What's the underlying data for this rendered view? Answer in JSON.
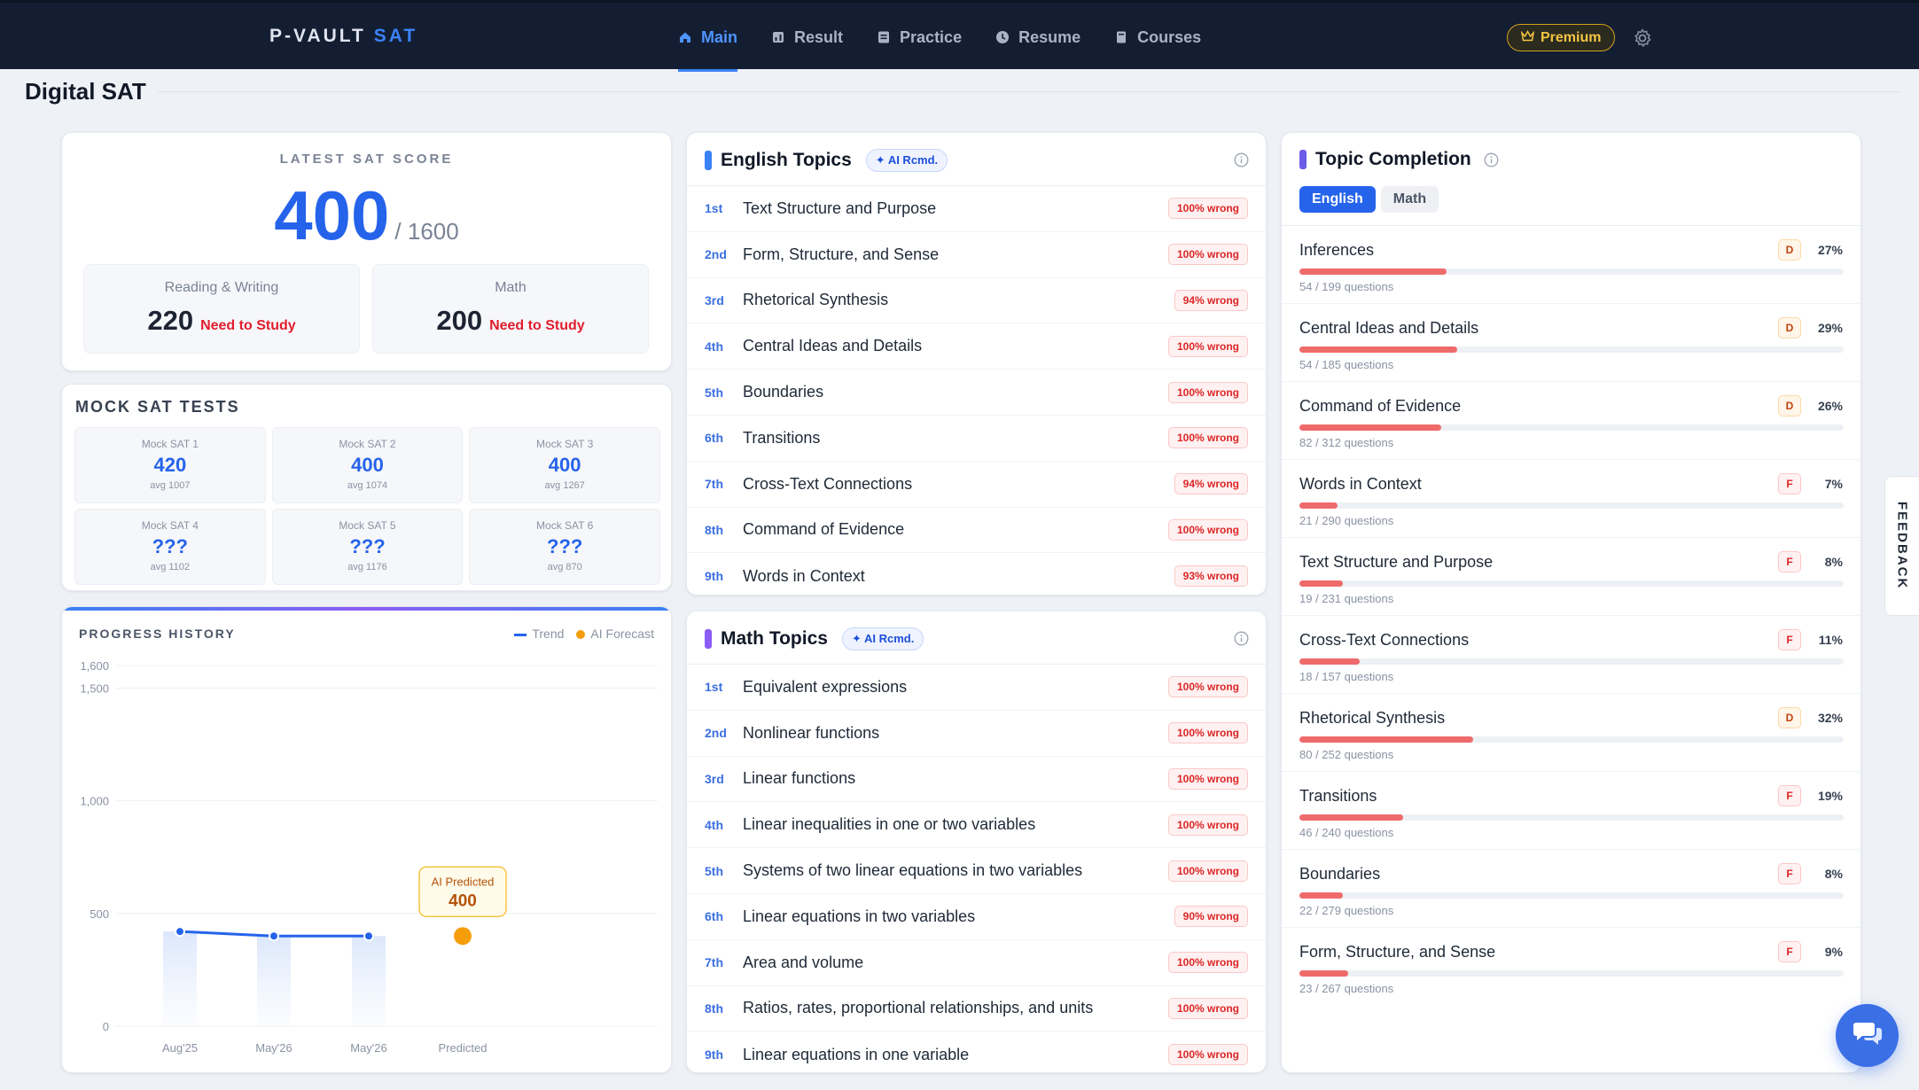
{
  "nav": {
    "logo_main": "P-VAULT",
    "logo_accent": "SAT",
    "items": [
      {
        "label": "Main",
        "icon": "home-icon"
      },
      {
        "label": "Result",
        "icon": "chart-icon"
      },
      {
        "label": "Practice",
        "icon": "doc-icon"
      },
      {
        "label": "Resume",
        "icon": "clock-icon"
      },
      {
        "label": "Courses",
        "icon": "book-icon"
      }
    ],
    "active": "Main",
    "premium": "Premium"
  },
  "page": {
    "title": "Digital SAT"
  },
  "latest": {
    "label": "LATEST SAT SCORE",
    "score": "400",
    "total": "/ 1600",
    "rw_label": "Reading & Writing",
    "rw_score": "220",
    "rw_status": "Need to Study",
    "math_label": "Math",
    "math_score": "200",
    "math_status": "Need to Study"
  },
  "mock": {
    "title": "MOCK SAT TESTS",
    "tests": [
      {
        "name": "Mock SAT 1",
        "score": "420",
        "avg": "avg 1007"
      },
      {
        "name": "Mock SAT 2",
        "score": "400",
        "avg": "avg 1074"
      },
      {
        "name": "Mock SAT 3",
        "score": "400",
        "avg": "avg 1267"
      },
      {
        "name": "Mock SAT 4",
        "score": "???",
        "avg": "avg 1102"
      },
      {
        "name": "Mock SAT 5",
        "score": "???",
        "avg": "avg 1176"
      },
      {
        "name": "Mock SAT 6",
        "score": "???",
        "avg": "avg 870"
      }
    ]
  },
  "progress": {
    "title": "PROGRESS HISTORY",
    "legend_trend": "Trend",
    "legend_forecast": "AI Forecast",
    "predicted_label": "AI Predicted",
    "predicted_value": "400"
  },
  "chart_data": {
    "type": "line",
    "categories": [
      "Aug'25",
      "May'26",
      "May'26",
      "Predicted"
    ],
    "series": [
      {
        "name": "Trend",
        "values": [
          420,
          400,
          400,
          null
        ]
      },
      {
        "name": "AI Forecast",
        "values": [
          null,
          null,
          null,
          400
        ]
      }
    ],
    "yticks": [
      0,
      500,
      1000,
      1500,
      1600
    ],
    "ytick_labels": [
      "0",
      "500",
      "1,000",
      "1,500",
      "1,600"
    ],
    "ylim": [
      0,
      1600
    ],
    "colors": {
      "trend": "#2563eb",
      "forecast": "#f59e0b"
    }
  },
  "english": {
    "title": "English Topics",
    "ai_badge": "✦ AI Rcmd.",
    "topics": [
      {
        "rank": "1st",
        "name": "Text Structure and Purpose",
        "badge": "100% wrong"
      },
      {
        "rank": "2nd",
        "name": "Form, Structure, and Sense",
        "badge": "100% wrong"
      },
      {
        "rank": "3rd",
        "name": "Rhetorical Synthesis",
        "badge": "94% wrong"
      },
      {
        "rank": "4th",
        "name": "Central Ideas and Details",
        "badge": "100% wrong"
      },
      {
        "rank": "5th",
        "name": "Boundaries",
        "badge": "100% wrong"
      },
      {
        "rank": "6th",
        "name": "Transitions",
        "badge": "100% wrong"
      },
      {
        "rank": "7th",
        "name": "Cross-Text Connections",
        "badge": "94% wrong"
      },
      {
        "rank": "8th",
        "name": "Command of Evidence",
        "badge": "100% wrong"
      },
      {
        "rank": "9th",
        "name": "Words in Context",
        "badge": "93% wrong"
      }
    ]
  },
  "math": {
    "title": "Math Topics",
    "ai_badge": "✦ AI Rcmd.",
    "topics": [
      {
        "rank": "1st",
        "name": "Equivalent expressions",
        "badge": "100% wrong"
      },
      {
        "rank": "2nd",
        "name": "Nonlinear functions",
        "badge": "100% wrong"
      },
      {
        "rank": "3rd",
        "name": "Linear functions",
        "badge": "100% wrong"
      },
      {
        "rank": "4th",
        "name": "Linear inequalities in one or two variables",
        "badge": "100% wrong"
      },
      {
        "rank": "5th",
        "name": "Systems of two linear equations in two variables",
        "badge": "100% wrong"
      },
      {
        "rank": "6th",
        "name": "Linear equations in two variables",
        "badge": "90% wrong"
      },
      {
        "rank": "7th",
        "name": "Area and volume",
        "badge": "100% wrong"
      },
      {
        "rank": "8th",
        "name": "Ratios, rates, proportional relationships, and units",
        "badge": "100% wrong"
      },
      {
        "rank": "9th",
        "name": "Linear equations in one variable",
        "badge": "100% wrong"
      }
    ]
  },
  "completion": {
    "title": "Topic Completion",
    "tabs": [
      "English",
      "Math"
    ],
    "active_tab": "English",
    "items": [
      {
        "name": "Inferences",
        "grade": "D",
        "pct": "27%",
        "progress": 0.27,
        "questions": "54 / 199 questions"
      },
      {
        "name": "Central Ideas and Details",
        "grade": "D",
        "pct": "29%",
        "progress": 0.29,
        "questions": "54 / 185 questions"
      },
      {
        "name": "Command of Evidence",
        "grade": "D",
        "pct": "26%",
        "progress": 0.26,
        "questions": "82 / 312 questions"
      },
      {
        "name": "Words in Context",
        "grade": "F",
        "pct": "7%",
        "progress": 0.07,
        "questions": "21 / 290 questions"
      },
      {
        "name": "Text Structure and Purpose",
        "grade": "F",
        "pct": "8%",
        "progress": 0.08,
        "questions": "19 / 231 questions"
      },
      {
        "name": "Cross-Text Connections",
        "grade": "F",
        "pct": "11%",
        "progress": 0.11,
        "questions": "18 / 157 questions"
      },
      {
        "name": "Rhetorical Synthesis",
        "grade": "D",
        "pct": "32%",
        "progress": 0.32,
        "questions": "80 / 252 questions"
      },
      {
        "name": "Transitions",
        "grade": "F",
        "pct": "19%",
        "progress": 0.19,
        "questions": "46 / 240 questions"
      },
      {
        "name": "Boundaries",
        "grade": "F",
        "pct": "8%",
        "progress": 0.08,
        "questions": "22 / 279 questions"
      },
      {
        "name": "Form, Structure, and Sense",
        "grade": "F",
        "pct": "9%",
        "progress": 0.09,
        "questions": "23 / 267 questions"
      }
    ]
  },
  "feedback": "FEEDBACK",
  "colors": {
    "brand": "#2563eb",
    "nav_bg": "#141e33",
    "danger": "#dc2626",
    "premium": "#f5c542"
  }
}
